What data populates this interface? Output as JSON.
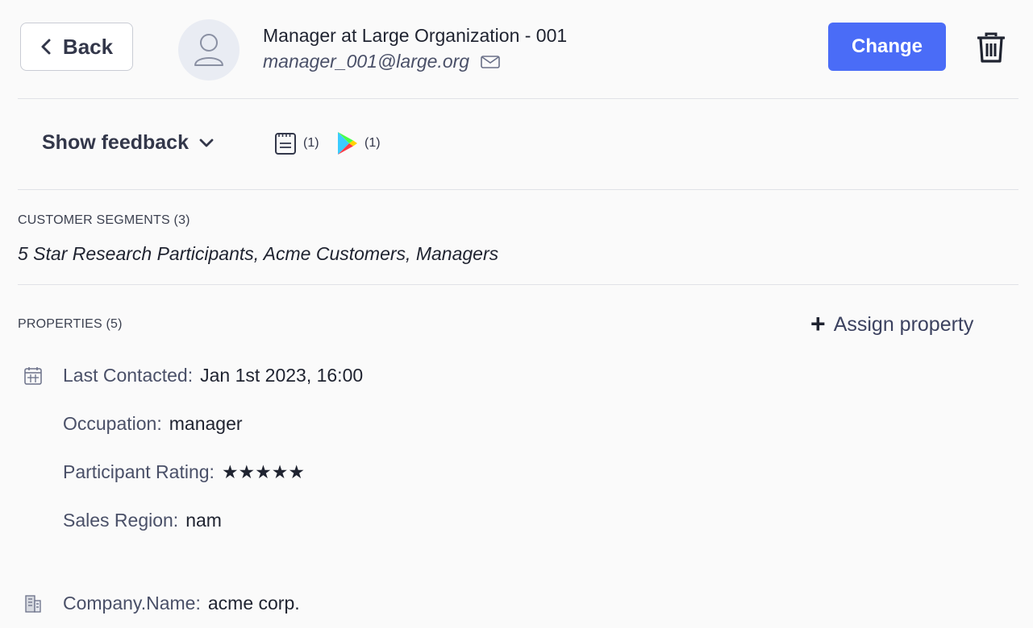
{
  "header": {
    "back_label": "Back",
    "user_name": "Manager at Large Organization - 001",
    "user_email": "manager_001@large.org",
    "change_label": "Change",
    "accent_color": "#4a6cf7"
  },
  "feedback": {
    "toggle_label": "Show feedback",
    "sources": [
      {
        "icon": "notepad-icon",
        "count": "(1)"
      },
      {
        "icon": "google-play-icon",
        "count": "(1)"
      }
    ]
  },
  "segments": {
    "label": "CUSTOMER SEGMENTS (3)",
    "value": "5 Star Research Participants, Acme Customers, Managers"
  },
  "properties": {
    "label": "PROPERTIES (5)",
    "assign_label": "Assign property",
    "items": [
      {
        "icon": "calendar-icon",
        "key": "Last Contacted:",
        "value": "Jan 1st 2023, 16:00"
      },
      {
        "icon": "",
        "key": "Occupation:",
        "value": "manager"
      },
      {
        "icon": "",
        "key": "Participant Rating:",
        "value": "★★★★★"
      },
      {
        "icon": "",
        "key": "Sales Region:",
        "value": "nam"
      },
      {
        "icon": "building-icon",
        "key": "Company.Name:",
        "value": "acme corp."
      }
    ]
  }
}
